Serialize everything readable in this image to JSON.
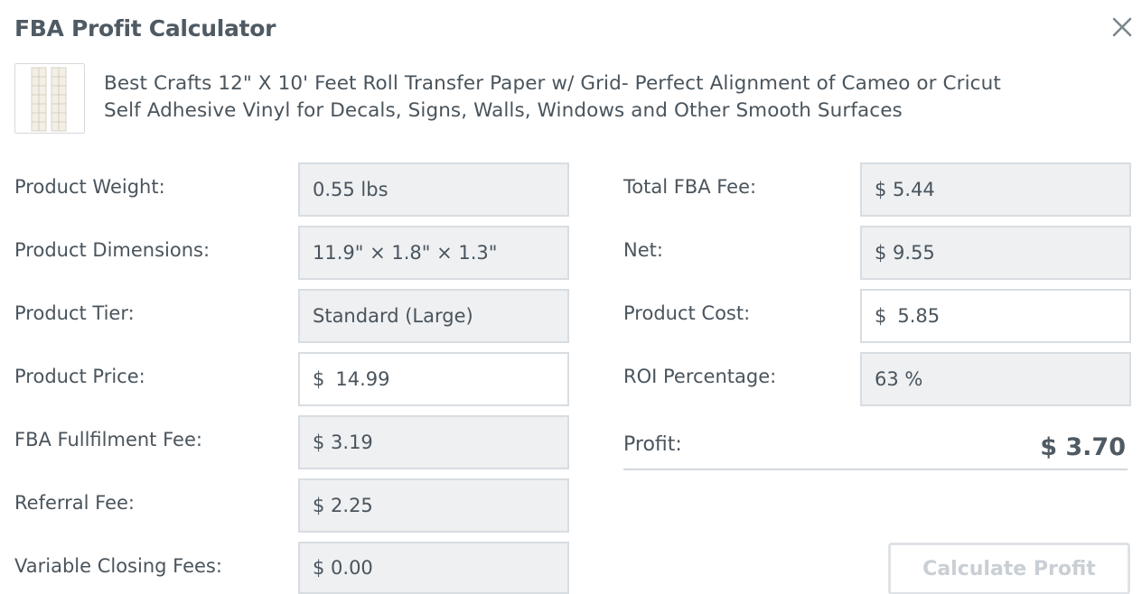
{
  "header": {
    "title": "FBA Profit Calculator",
    "close_icon": "close-icon"
  },
  "product": {
    "title_line1": "Best Crafts 12\" X 10' Feet Roll Transfer Paper w/ Grid- Perfect Alignment of Cameo or Cricut",
    "title_line2": "Self Adhesive Vinyl for Decals, Signs, Walls, Windows and Other Smooth Surfaces"
  },
  "left": {
    "weight_label": "Product Weight:",
    "weight_value": "0.55 lbs",
    "dimensions_label": "Product Dimensions:",
    "dimensions_value": "11.9\" × 1.8\" × 1.3\"",
    "tier_label": "Product Tier:",
    "tier_value": "Standard (Large)",
    "price_label": "Product Price:",
    "price_currency": "$",
    "price_value": "14.99",
    "fulfilment_label": "FBA Fullfilment Fee:",
    "fulfilment_value": "$ 3.19",
    "referral_label": "Referral Fee:",
    "referral_value": "$ 2.25",
    "closing_label": "Variable Closing Fees:",
    "closing_value": "$ 0.00"
  },
  "right": {
    "total_fee_label": "Total FBA Fee:",
    "total_fee_value": "$ 5.44",
    "net_label": "Net:",
    "net_value": "$ 9.55",
    "cost_label": "Product Cost:",
    "cost_currency": "$",
    "cost_value": "5.85",
    "roi_label": "ROI Percentage:",
    "roi_value": "63 %",
    "profit_label": "Profit:",
    "profit_value": "$ 3.70"
  },
  "actions": {
    "calculate_label": "Calculate Profit"
  },
  "colors": {
    "text": "#4a545c",
    "readonly_bg": "#eef0f2",
    "border": "#d8dde2",
    "disabled_text": "#c9cfd4"
  }
}
